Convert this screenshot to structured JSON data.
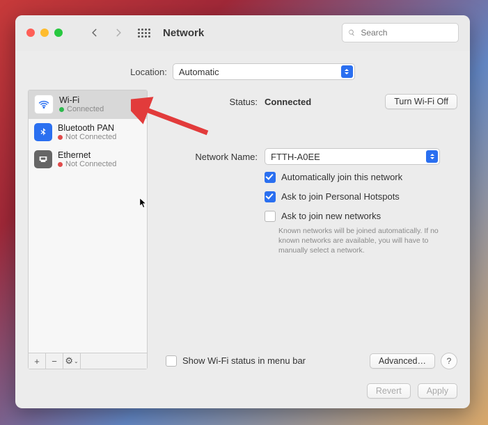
{
  "window": {
    "title": "Network"
  },
  "search": {
    "placeholder": "Search"
  },
  "location": {
    "label": "Location:",
    "value": "Automatic"
  },
  "sidebar": {
    "items": [
      {
        "name": "Wi-Fi",
        "status": "Connected",
        "dot": "green"
      },
      {
        "name": "Bluetooth PAN",
        "status": "Not Connected",
        "dot": "red"
      },
      {
        "name": "Ethernet",
        "status": "Not Connected",
        "dot": "red"
      }
    ],
    "footer": {
      "add": "+",
      "remove": "−",
      "gear": "⚙︎"
    }
  },
  "detail": {
    "status_label": "Status:",
    "status_value": "Connected",
    "wifi_off_btn": "Turn Wi-Fi Off",
    "network_name_label": "Network Name:",
    "network_name_value": "FTTH-A0EE",
    "auto_join": "Automatically join this network",
    "ask_hotspot": "Ask to join Personal Hotspots",
    "ask_new": "Ask to join new networks",
    "help": "Known networks will be joined automatically. If no known networks are available, you will have to manually select a network.",
    "show_menubar": "Show Wi-Fi status in menu bar",
    "advanced_btn": "Advanced…",
    "help_btn": "?"
  },
  "footer": {
    "revert": "Revert",
    "apply": "Apply"
  }
}
